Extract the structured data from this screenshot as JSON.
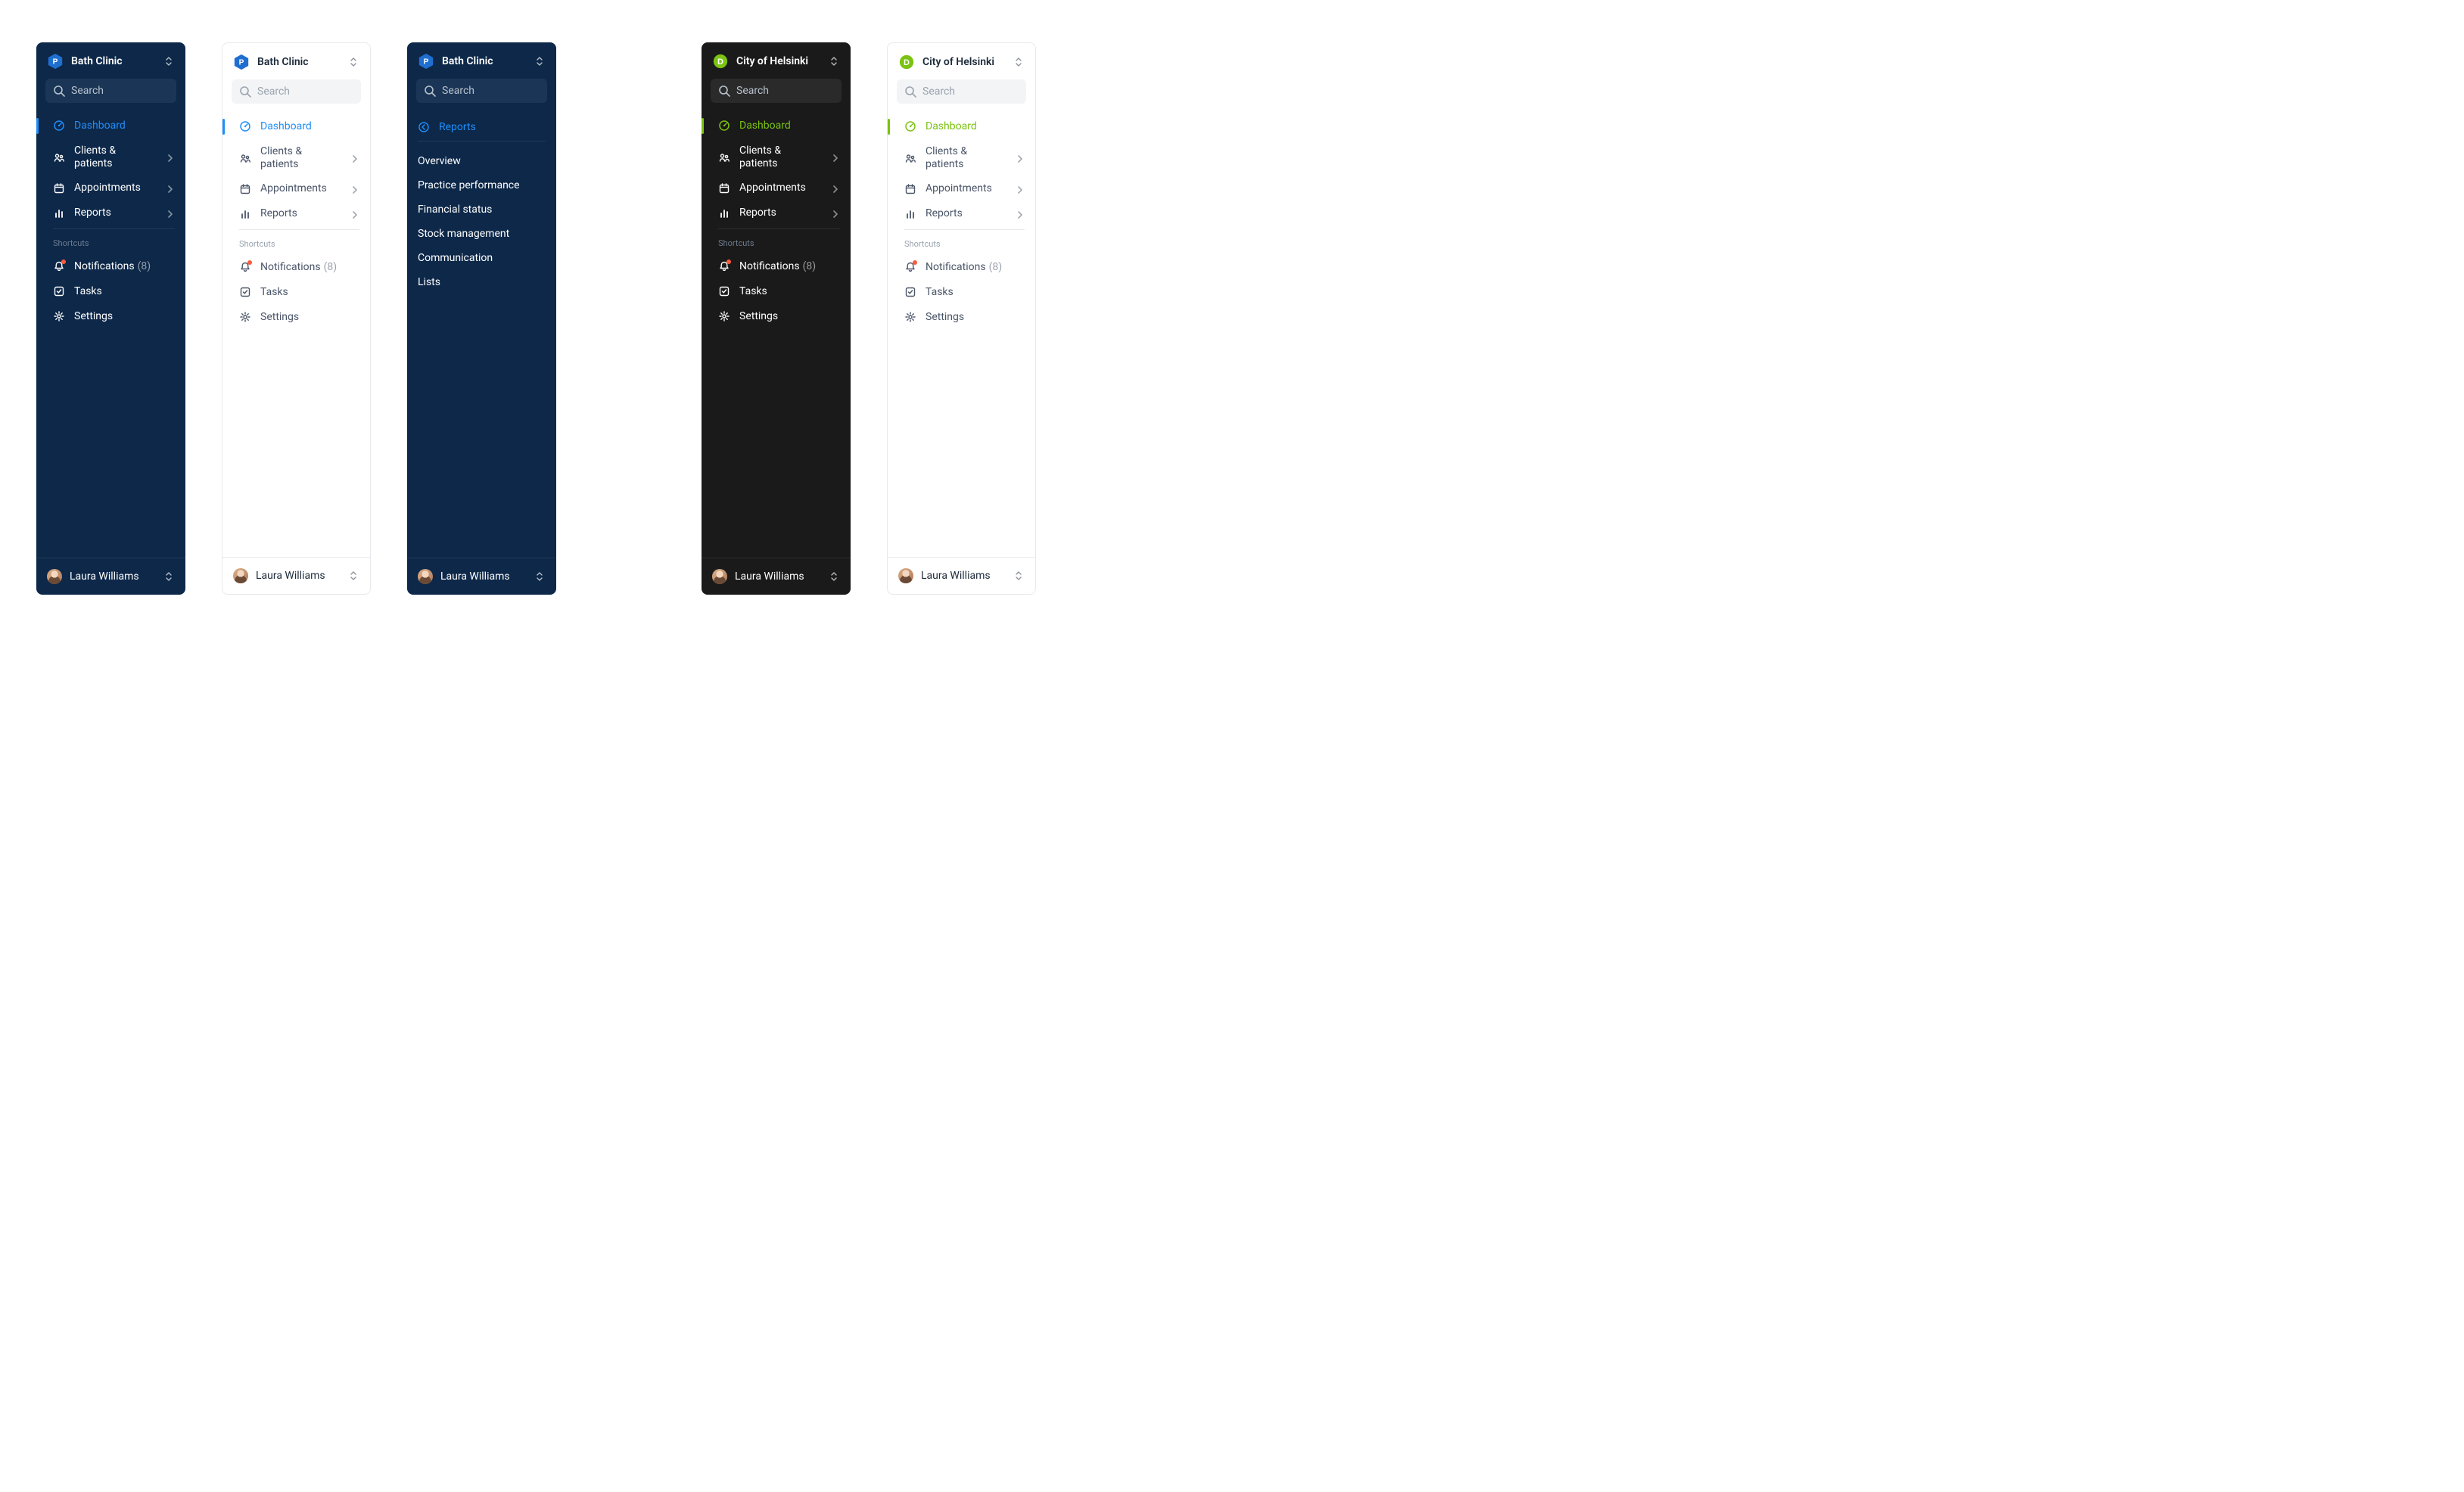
{
  "search_placeholder": "Search",
  "shortcuts_label": "Shortcuts",
  "user_name": "Laura Williams",
  "notifications_count": "(8)",
  "orgs": {
    "bath": {
      "name": "Bath Clinic",
      "letter": "P",
      "hex_color": "#1f6fd1"
    },
    "helsinki": {
      "name": "City of Helsinki",
      "letter": "D",
      "hex_color": "#7bc212"
    }
  },
  "nav": {
    "dashboard": "Dashboard",
    "clients": "Clients & patients",
    "appointments": "Appointments",
    "reports": "Reports"
  },
  "shortcuts": {
    "notifications": "Notifications",
    "tasks": "Tasks",
    "settings": "Settings"
  },
  "reports_sub": {
    "title": "Reports",
    "items": [
      "Overview",
      "Practice performance",
      "Financial status",
      "Stock management",
      "Communication",
      "Lists"
    ]
  }
}
